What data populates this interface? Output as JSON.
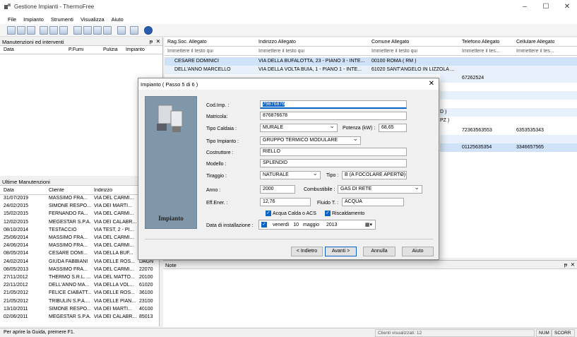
{
  "app": {
    "title": "Gestione Impianti - ThermoFree",
    "minimize": "–",
    "maximize": "☐",
    "close": "✕"
  },
  "menu": [
    "File",
    "Impianto",
    "Strumenti",
    "Visualizza",
    "Aiuto"
  ],
  "toolbar_icons": [
    "new-icon",
    "open-icon",
    "list-icon",
    "document-icon",
    "print-icon",
    "print-preview-icon",
    "search-icon",
    "zoom-icon",
    "copy-icon",
    "paste-icon",
    "report-icon",
    "plugin-icon",
    "help-icon"
  ],
  "left_top_panel": {
    "title": "Manutenzioni ed interventi",
    "pin": "ᵽ",
    "close": "✕",
    "columns": [
      "Data",
      "P.Fumi",
      "Pulizia",
      "Impianto"
    ]
  },
  "clients_grid": {
    "columns": [
      "Rag.Soc. Allegato",
      "Indirizzo Allegato",
      "Comune Allegato",
      "Telefono Allegato",
      "Cellulare Allegato"
    ],
    "filter_placeholders": [
      "Immettere il testo qui",
      "Immettere il testo qui",
      "Immettere il testo qui",
      "Immettere il tes...",
      "Immettere il tes..."
    ],
    "rows": [
      [
        "CESARE DOMINICI",
        "VIA DELLA BUFALOTTA, 23 - PIANO 3 - INTE...",
        "00100 ROMA ( RM )",
        "",
        ""
      ],
      [
        "DELL'ANNO MARCELLO",
        "VIA DELLA VOLTA BUIA, 1 - PIANO 1 - INTE...",
        "61020 SANT'ANGELO IN LIZZOLA ...",
        "",
        ""
      ]
    ],
    "partial_right": [
      {
        "comune": "",
        "tel": "67262524",
        "cell": ""
      },
      {
        "comune": "",
        "tel": "",
        "cell": ""
      },
      {
        "comune": "D )",
        "tel": "",
        "cell": ""
      },
      {
        "comune": "PZ )",
        "tel": "",
        "cell": ""
      },
      {
        "comune": "",
        "tel": "72363563553",
        "cell": "6353535343"
      },
      {
        "comune": "",
        "tel": "",
        "cell": ""
      },
      {
        "comune": "",
        "tel": "01125635354",
        "cell": "3346657565"
      }
    ]
  },
  "maintenance": {
    "title": "Ultime Manutenzioni",
    "columns": [
      "Data",
      "Cliente",
      "Indirizzo"
    ],
    "rows": [
      [
        "31/07/2019",
        "MASSIMO FRA...",
        "VIA DEL CARMI..."
      ],
      [
        "24/02/2015",
        "SIMONE RESPO...",
        "VIA DEI MARTI..."
      ],
      [
        "15/02/2015",
        "FERNANDO FA...",
        "VIA DEL CARMI..."
      ],
      [
        "12/02/2015",
        "MEGESTAR S.P.A.",
        "VIA DEI CALABR..."
      ],
      [
        "08/10/2014",
        "TESTACCIO",
        "VIA TEST, 2 - PI..."
      ],
      [
        "25/06/2014",
        "MASSIMO FRA...",
        "VIA DEL CARMI..."
      ],
      [
        "24/06/2014",
        "MASSIMO FRA...",
        "VIA DEL CARMI..."
      ],
      [
        "08/05/2014",
        "CESARE DOMI...",
        "VIA DELLA BUF..."
      ],
      [
        "24/02/2014",
        "GIUDA FABBIANI",
        "VIA DELLE ROS..."
      ],
      [
        "08/05/2013",
        "MASSIMO FRA...",
        "VIA DEL CARMI..."
      ],
      [
        "27/11/2012",
        "THERMO S.R.L. ...",
        "VIA DEL MATTO..."
      ],
      [
        "22/11/2012",
        "DELL'ANNO MA...",
        "VIA DELLA VOL..."
      ],
      [
        "21/05/2012",
        "FELICE CIABATT...",
        "VIA DELLE ROS..."
      ],
      [
        "21/05/2012",
        "TRIBULIN S.P.A....",
        "VIA DELLE PIAN..."
      ],
      [
        "13/10/2011",
        "SIMONE RESPO...",
        "VIA DEI MARTI..."
      ],
      [
        "02/06/2011",
        "MEGESTAR S.P.A.",
        "VIA DEI CALABR..."
      ]
    ],
    "extra_col": [
      "",
      "",
      "",
      "",
      "",
      "",
      "",
      "",
      "DAGN",
      "22070",
      "20100",
      "61020",
      "36100",
      "23100",
      "40100",
      "85013"
    ]
  },
  "notes_panel": {
    "title": "Note",
    "pin": "ᵽ",
    "close": "✕"
  },
  "dialog": {
    "title": "Impianto ( Passo 5 di 6 )",
    "close": "✕",
    "image_caption": "Impianto",
    "labels": {
      "cod_imp": "Cod.Imp. :",
      "matricola": "Matricola:",
      "tipo_caldaia": "Tipo Caldaia :",
      "potenza": "Potenza (kW) :",
      "tipo_impianto": "Tipo Impianto :",
      "costruttore": "Costruttore :",
      "modello": "Modello :",
      "tiraggio": "Tiraggio :",
      "tipo": "Tipo :",
      "anno": "Anno :",
      "combustibile": "Combustibile :",
      "eff_ener": "Eff.Ener. :",
      "fluido": "Fluido T. :",
      "acqua_calda": "Acqua Calda o ACS",
      "riscaldamento": "Riscaldamento",
      "data_installazione": "Data di installazione :"
    },
    "values": {
      "cod_imp": "79876876",
      "matricola": "876876678",
      "tipo_caldaia": "MURALE",
      "potenza": "68,65",
      "tipo_impianto": "GRUPPO TERMICO MODULARE",
      "costruttore": "RIELLO",
      "modello": "SPLENDID",
      "tiraggio": "NATURALE",
      "tipo": "B (A FOCOLARE APERTO)",
      "anno": "2000",
      "combustibile": "GAS DI RETE",
      "eff_ener": "12,76",
      "fluido": "ACQUA",
      "date_weekday": "venerdì",
      "date_day": "10",
      "date_month": "maggio",
      "date_year": "2013"
    },
    "buttons": {
      "back": "< Indietro",
      "next": "Avanti >",
      "cancel": "Annulla",
      "help": "Aiuto"
    }
  },
  "status": {
    "help": "Per aprire la Guida, premere F1.",
    "clients": "Clienti visualizzati: 12",
    "num": "NUM",
    "scroll": "SCORR"
  }
}
